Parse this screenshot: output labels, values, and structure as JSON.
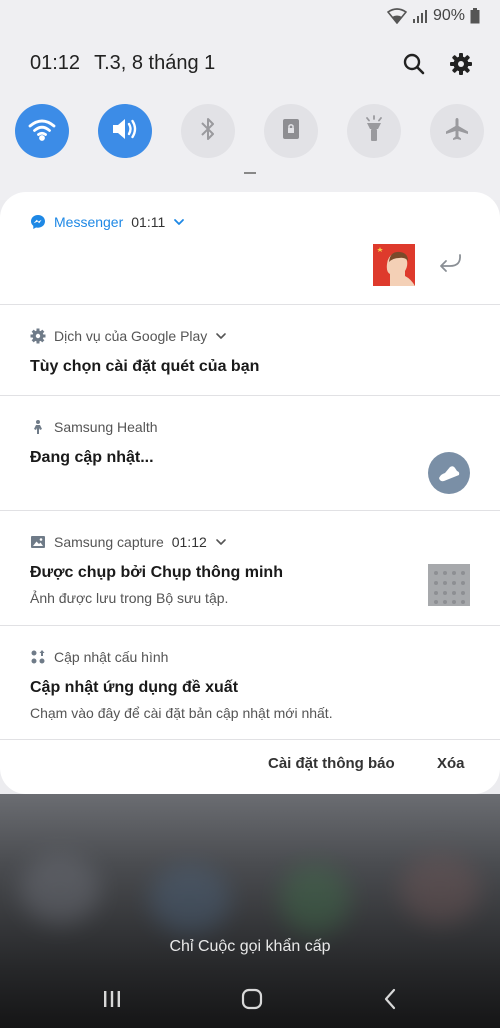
{
  "status": {
    "battery_text": "90%"
  },
  "header": {
    "time": "01:12",
    "date": "T.3, 8 tháng 1",
    "search_icon": "search-icon",
    "settings_icon": "gear-icon"
  },
  "quick_settings": [
    {
      "name": "wifi",
      "icon": "wifi-icon",
      "on": true
    },
    {
      "name": "sound",
      "icon": "volume-icon",
      "on": true
    },
    {
      "name": "bluetooth",
      "icon": "bluetooth-icon",
      "on": false
    },
    {
      "name": "rotation",
      "icon": "screen-rotation-icon",
      "on": false
    },
    {
      "name": "flashlight",
      "icon": "flashlight-icon",
      "on": false
    },
    {
      "name": "airplane",
      "icon": "airplane-icon",
      "on": false
    }
  ],
  "notifications": {
    "messenger": {
      "app": "Messenger",
      "time": "01:11"
    },
    "google_play": {
      "app": "Dịch vụ của Google Play",
      "title": "Tùy chọn cài đặt quét của bạn"
    },
    "samsung_health": {
      "app": "Samsung Health",
      "title": "Đang cập nhật..."
    },
    "samsung_capture": {
      "app": "Samsung capture",
      "time": "01:12",
      "title": "Được chụp bởi Chụp thông minh",
      "body": "Ảnh được lưu trong Bộ sưu tập."
    },
    "config_update": {
      "app": "Cập nhật cấu hình",
      "title": "Cập nhật ứng dụng đề xuất",
      "body": "Chạm vào đây để cài đặt bản cập nhật mới nhất."
    }
  },
  "actions": {
    "settings_label": "Cài đặt thông báo",
    "clear_label": "Xóa"
  },
  "lockscreen": {
    "emergency_label": "Chỉ Cuộc gọi khẩn cấp"
  },
  "colors": {
    "accent": "#3c8ce7",
    "messenger": "#1e88e5",
    "card": "#ffffff"
  }
}
